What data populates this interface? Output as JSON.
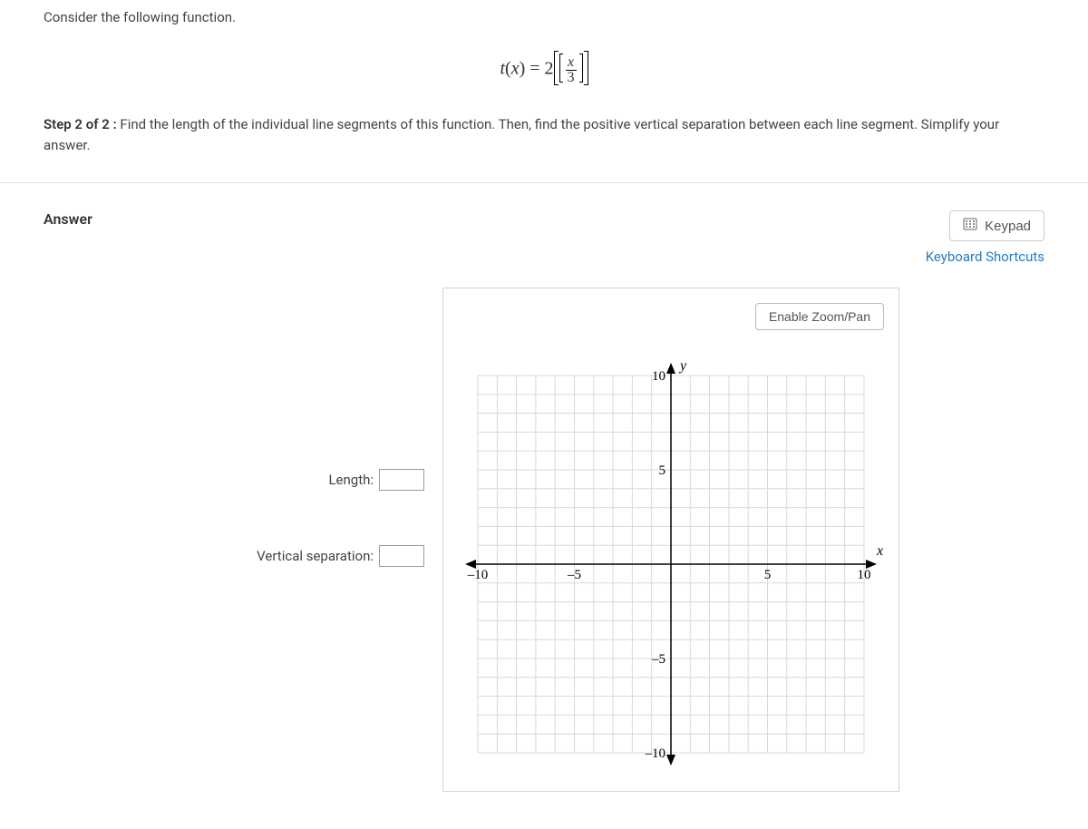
{
  "question": {
    "prompt": "Consider the following function.",
    "equation": {
      "lhs_fn": "t",
      "lhs_var": "x",
      "coef": "2",
      "frac_num": "x",
      "frac_den": "3"
    },
    "step_label": "Step 2 of 2 :",
    "step_text": "Find the length of the individual line segments of this function. Then, find the positive vertical separation between each line segment. Simplify your answer."
  },
  "answer": {
    "heading": "Answer",
    "keypad_label": "Keypad",
    "keyboard_shortcuts_label": "Keyboard Shortcuts",
    "length_label": "Length:",
    "length_value": "",
    "vsep_label": "Vertical separation:",
    "vsep_value": "",
    "zoom_label": "Enable Zoom/Pan"
  },
  "chart_data": {
    "type": "scatter",
    "title": "",
    "xlabel": "x",
    "ylabel": "y",
    "xlim": [
      -10,
      10
    ],
    "ylim": [
      -10,
      10
    ],
    "x_ticks": [
      -10,
      -5,
      5,
      10
    ],
    "y_ticks": [
      -10,
      -5,
      5,
      10
    ],
    "grid": true,
    "series": []
  }
}
